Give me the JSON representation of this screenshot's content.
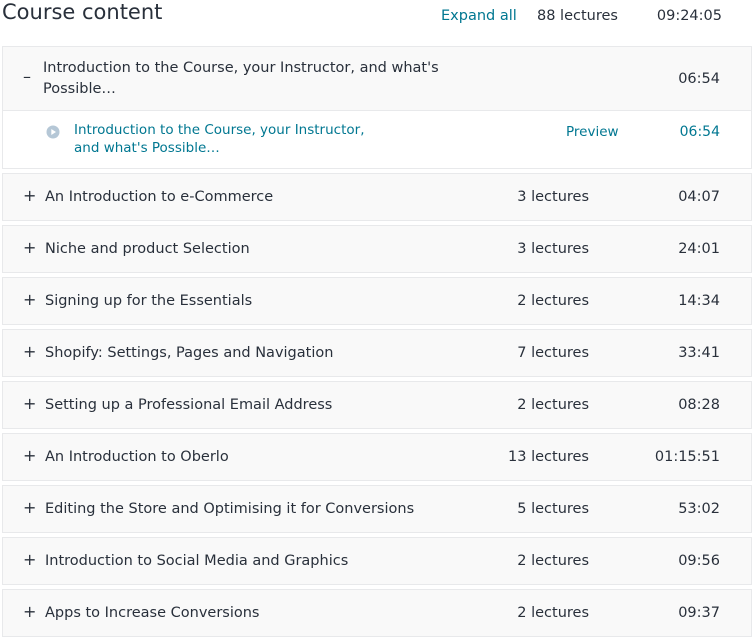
{
  "header": {
    "title": "Course content",
    "expand_all": "Expand all",
    "total_lectures": "88 lectures",
    "total_duration": "09:24:05"
  },
  "open_section": {
    "toggle": "–",
    "title": "Introduction to the Course, your Instructor, and what's Possible…",
    "duration": "06:54",
    "lecture": {
      "title": "Introduction to the Course, your Instructor, and what's Possible…",
      "preview": "Preview",
      "duration": "06:54"
    }
  },
  "sections": [
    {
      "toggle": "+",
      "title": "An Introduction to e-Commerce",
      "lectures": "3 lectures",
      "duration": "04:07"
    },
    {
      "toggle": "+",
      "title": "Niche and product Selection",
      "lectures": "3 lectures",
      "duration": "24:01"
    },
    {
      "toggle": "+",
      "title": "Signing up for the Essentials",
      "lectures": "2 lectures",
      "duration": "14:34"
    },
    {
      "toggle": "+",
      "title": "Shopify: Settings, Pages and Navigation",
      "lectures": "7 lectures",
      "duration": "33:41"
    },
    {
      "toggle": "+",
      "title": "Setting up a Professional Email Address",
      "lectures": "2 lectures",
      "duration": "08:28"
    },
    {
      "toggle": "+",
      "title": "An Introduction to Oberlo",
      "lectures": "13 lectures",
      "duration": "01:15:51"
    },
    {
      "toggle": "+",
      "title": "Editing the Store and Optimising it for Conversions",
      "lectures": "5 lectures",
      "duration": "53:02"
    },
    {
      "toggle": "+",
      "title": "Introduction to Social Media and Graphics",
      "lectures": "2 lectures",
      "duration": "09:56"
    },
    {
      "toggle": "+",
      "title": "Apps to Increase Conversions",
      "lectures": "2 lectures",
      "duration": "09:37"
    }
  ],
  "colors": {
    "text": "#29303b",
    "link": "#007791",
    "section_bg": "#f9f9f9",
    "border": "#e8e9eb",
    "play_icon": "#b5c7d6"
  }
}
